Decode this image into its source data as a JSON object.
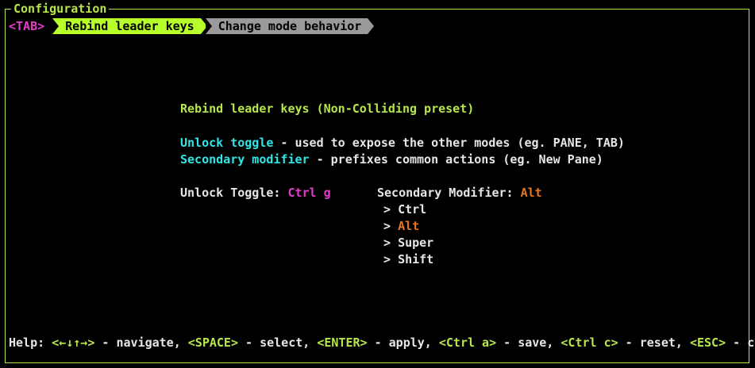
{
  "window": {
    "title": "Configuration"
  },
  "tabs": {
    "key_hint": "<TAB>",
    "items": [
      {
        "label": "Rebind leader keys"
      },
      {
        "label": "Change mode behavior"
      }
    ]
  },
  "content": {
    "heading": "Rebind leader keys (Non-Colliding preset)",
    "desc1_term": "Unlock toggle",
    "desc1_text": " - used to expose the other modes (eg. PANE, TAB)",
    "desc2_term": "Secondary modifier",
    "desc2_text": " - prefixes common actions (eg. New Pane)",
    "unlock_label": "Unlock Toggle: ",
    "unlock_value": "Ctrl g",
    "secondary_label": "Secondary Modifier: ",
    "secondary_value": "Alt",
    "options": [
      {
        "prefix": "> ",
        "label": "Ctrl"
      },
      {
        "prefix": "> ",
        "label": "Alt"
      },
      {
        "prefix": "> ",
        "label": "Super"
      },
      {
        "prefix": "> ",
        "label": "Shift"
      }
    ]
  },
  "help": {
    "label": "Help: ",
    "k1": "<←↓↑→>",
    "t1": " - navigate, ",
    "k2": "<SPACE>",
    "t2": " - select, ",
    "k3": "<ENTER>",
    "t3": " - apply, ",
    "k4": "<Ctrl a>",
    "t4": " - save, ",
    "k5": "<Ctrl c>",
    "t5": " - reset, ",
    "k6": "<ESC>",
    "t6": " - close"
  },
  "colors": {
    "accent_green": "#b7e64a",
    "active_tab": "#b7ff2a",
    "inactive_tab": "#9a9a9a",
    "cyan": "#2ee6e6",
    "magenta": "#e23ec9",
    "orange": "#e8761e",
    "background": "#000000"
  }
}
